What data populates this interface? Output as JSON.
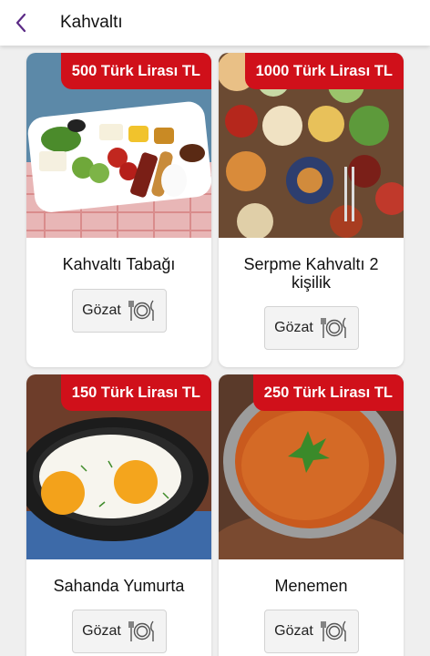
{
  "header": {
    "title": "Kahvaltı",
    "back_icon": "chevron-left-icon",
    "accent": "#5b2a86"
  },
  "products": [
    {
      "name": "Kahvaltı Tabağı",
      "price": "500 Türk Lirası TL",
      "button": "Gözat",
      "button_icon": "plate-cutlery-icon"
    },
    {
      "name": "Serpme Kahvaltı 2 kişilik",
      "price": "1000 Türk Lirası TL",
      "button": "Gözat",
      "button_icon": "plate-cutlery-icon"
    },
    {
      "name": "Sahanda Yumurta",
      "price": "150 Türk Lirası TL",
      "button": "Gözat",
      "button_icon": "plate-cutlery-icon"
    },
    {
      "name": "Menemen",
      "price": "250 Türk Lirası TL",
      "button": "Gözat",
      "button_icon": "plate-cutlery-icon"
    }
  ],
  "colors": {
    "price_badge": "#d0101a",
    "background": "#efefef",
    "card": "#ffffff"
  }
}
